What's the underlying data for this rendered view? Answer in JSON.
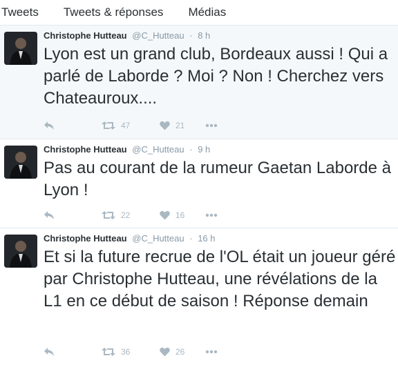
{
  "tabs": [
    "Tweets",
    "Tweets & réponses",
    "Médias"
  ],
  "colors": {
    "text": "#292f33",
    "muted": "#8899a6",
    "action": "#aab8c2",
    "highlight_bg": "#f5f8fa",
    "border": "#e1e8ed"
  },
  "tweets": [
    {
      "name": "Christophe Hutteau",
      "handle": "@C_Hutteau",
      "separator": "·",
      "time": "8 h",
      "text": "Lyon est un grand club, Bordeaux aussi ! Qui a parlé de Laborde ? Moi ? Non ! Cherchez vers Chateauroux....",
      "retweets": "47",
      "likes": "21"
    },
    {
      "name": "Christophe Hutteau",
      "handle": "@C_Hutteau",
      "separator": "·",
      "time": "9 h",
      "text": "Pas au courant de la rumeur Gaetan Laborde à Lyon !",
      "retweets": "22",
      "likes": "16"
    },
    {
      "name": "Christophe Hutteau",
      "handle": "@C_Hutteau",
      "separator": "·",
      "time": "16 h",
      "text": "Et si la future recrue de l'OL était un joueur géré par Christophe Hutteau, une révélations de la L1 en ce début de saison ! Réponse demain",
      "retweets": "36",
      "likes": "26"
    }
  ],
  "icons": [
    "reply-icon",
    "retweet-icon",
    "heart-icon",
    "more-icon"
  ]
}
